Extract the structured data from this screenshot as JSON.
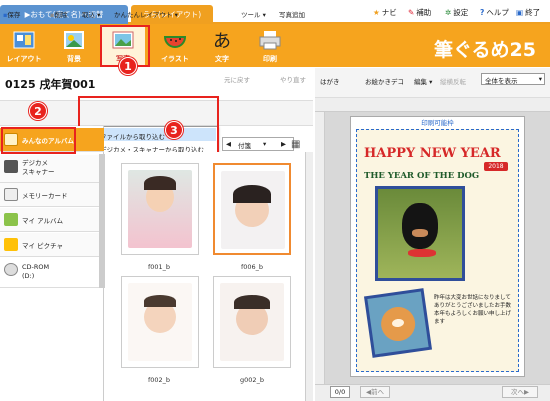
{
  "tabs": {
    "omote": "▶おもて(宛て名)へ切替",
    "ura": "うら(レイアウト)"
  },
  "menu": {
    "navi": "ナビ",
    "hojo": "補助",
    "settei": "設定",
    "help": "ヘルプ",
    "exit": "終了"
  },
  "ribbon": {
    "items": [
      "レイアウト",
      "背景",
      "写真",
      "イラスト",
      "文字",
      "印刷"
    ],
    "logo": "筆ぐるめ25"
  },
  "doc": {
    "title": "0125 戌年賀001",
    "undo": "元に戻す",
    "redo": "やり直す"
  },
  "toolbar": {
    "save": "保存",
    "delete": "削除",
    "import": "取込",
    "easy_layout": "かんたんレイアウト",
    "tools": "ツール",
    "add_photo": "写真追加"
  },
  "dropdown": {
    "items": [
      "ファイルから取り込む",
      "デジカメ・スキャナーから取り込む"
    ]
  },
  "sidebar": {
    "items": [
      "みんなのアルバム",
      "デジカメ\nスキャナー",
      "メモリーカード",
      "マイ アルバム",
      "マイ ピクチャ",
      "CD-ROM\n(D:)"
    ]
  },
  "grid": {
    "filter": "付箋",
    "photos": [
      "f001_b",
      "f006_b",
      "f002_b",
      "g002_b"
    ]
  },
  "right": {
    "hagaki": "はがき",
    "decor": "お絵かきデコ",
    "edit": "編集",
    "vertical": "縦横反転",
    "view": "全体を表示",
    "print_area": "印刷可能枠",
    "page": "0/0",
    "prev": "前へ",
    "next": "次へ"
  },
  "card": {
    "happy": "HAPPY NEW YEAR",
    "year_badge": "2018",
    "subtitle": "THE YEAR OF THE DOG",
    "message": "昨年は大変お世話になりましてありがとうございましたお手数本年もよろしくお願い申し上げます"
  },
  "callouts": [
    "1",
    "2",
    "3"
  ],
  "colors": {
    "accent": "#f6a41e",
    "callout": "#e8231e",
    "tab_blue": "#5b93d0"
  }
}
